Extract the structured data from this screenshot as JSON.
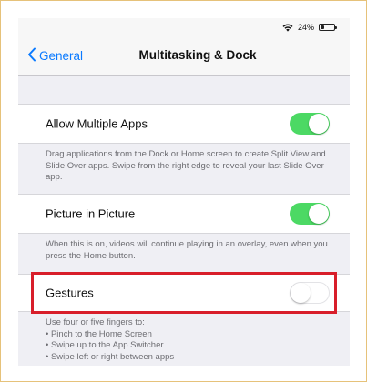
{
  "status_bar": {
    "battery_percent": "24%"
  },
  "nav": {
    "back_label": "General",
    "title": "Multitasking & Dock"
  },
  "settings": [
    {
      "label": "Allow Multiple Apps",
      "enabled": true,
      "footer": "Drag applications from the Dock or Home screen to create Split View and Slide Over apps. Swipe from the right edge to reveal your last Slide Over app."
    },
    {
      "label": "Picture in Picture",
      "enabled": true,
      "footer": "When this is on, videos will continue playing in an overlay, even when you press the Home button."
    },
    {
      "label": "Gestures",
      "enabled": false,
      "footer_intro": "Use four or five fingers to:",
      "footer_items": [
        "• Pinch to the Home Screen",
        "• Swipe up to the App Switcher",
        "• Swipe left or right between apps"
      ]
    }
  ],
  "colors": {
    "accent": "#0a7aff",
    "toggle_on": "#4cd964",
    "highlight": "#d81e2a",
    "frame_border": "#e6c27a"
  }
}
